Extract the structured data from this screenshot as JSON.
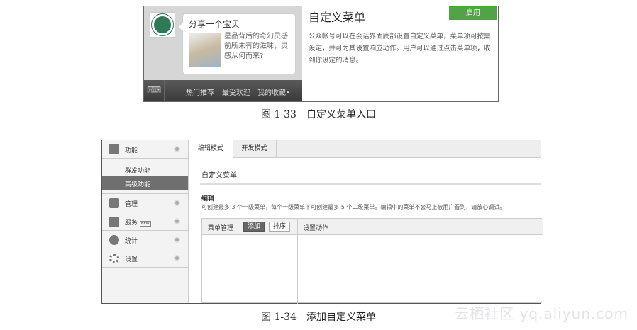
{
  "figure1": {
    "bubble_title": "分享一个宝贝",
    "bubble_text": "星品背后的奇幻灵感前所未有的滋味，灵感从何而来?",
    "menu": [
      "热门推荐",
      "最受欢迎",
      "我的收藏•"
    ],
    "title": "自定义菜单",
    "enable_button": "启用",
    "description": "公众帐号可以在会话界面底部设置自定义菜单，菜单项可按需设定，并可为其设置响应动作。用户可以通过点击菜单项，收到你设定的消息。",
    "caption": "图 1-33　自定义菜单入口"
  },
  "figure2": {
    "sidebar": [
      {
        "label": "功能",
        "icon": "grid-icon"
      },
      {
        "label": "管理",
        "icon": "inbox-icon"
      },
      {
        "label": "服务",
        "icon": "printer-icon",
        "badge": "NEW"
      },
      {
        "label": "统计",
        "icon": "pie-chart-icon"
      },
      {
        "label": "设置",
        "icon": "gear-icon"
      }
    ],
    "subitems": [
      "群发功能",
      "高级功能"
    ],
    "tabs": [
      "编辑模式",
      "开发模式"
    ],
    "title": "自定义菜单",
    "edit_heading": "编辑",
    "edit_desc": "可创建最多 3 个一级菜单，每个一级菜单下可创建最多 5 个二级菜单。编辑中的菜单不会马上被用户看到，请放心调试。",
    "table": {
      "menu_mgmt": "菜单管理",
      "add": "添加",
      "sort": "排序",
      "action": "设置动作"
    },
    "caption": "图 1-34　添加自定义菜单"
  },
  "watermark": "云栖社区 yq.aliyun.com",
  "colors": {
    "enable": "#52a346",
    "highlight": "#6f6f6f"
  }
}
